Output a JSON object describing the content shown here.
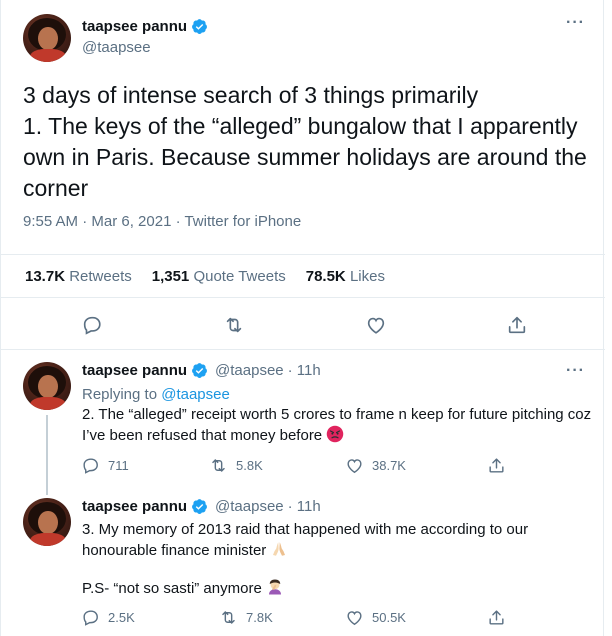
{
  "main_tweet": {
    "author_name": "taapsee pannu",
    "author_handle": "@taapsee",
    "body_lines": [
      "3 days of intense search of 3 things primarily",
      "1. The keys of the “alleged” bungalow that I apparently own in Paris. Because summer holidays are around the corner"
    ],
    "meta": "9:55 AM · Mar 6, 2021 · Twitter for iPhone",
    "stats": {
      "retweets_count": "13.7K",
      "retweets_label": "Retweets",
      "quotes_count": "1,351",
      "quotes_label": "Quote Tweets",
      "likes_count": "78.5K",
      "likes_label": "Likes"
    },
    "more_label": "···"
  },
  "replies": [
    {
      "author_name": "taapsee pannu",
      "author_handle": "@taapsee",
      "time": "· 11h",
      "replying_prefix": "Replying to",
      "replying_handle": "@taapsee",
      "text": "2. The “alleged” receipt worth 5 crores to frame n keep for future pitching coz I’ve been refused that money before",
      "reply_count": "711",
      "retweet_count": "5.8K",
      "like_count": "38.7K"
    },
    {
      "author_name": "taapsee pannu",
      "author_handle": "@taapsee",
      "time": "· 11h",
      "text": "3. My memory of 2013 raid that happened with me according to our honourable finance minister",
      "ps": "P.S- “not so sasti” anymore",
      "reply_count": "2.5K",
      "retweet_count": "7.8K",
      "like_count": "50.5K"
    }
  ],
  "colors": {
    "accent": "#1da1f2",
    "link": "#1b95e0",
    "muted": "#5b7083",
    "angry": "#e0245e"
  }
}
